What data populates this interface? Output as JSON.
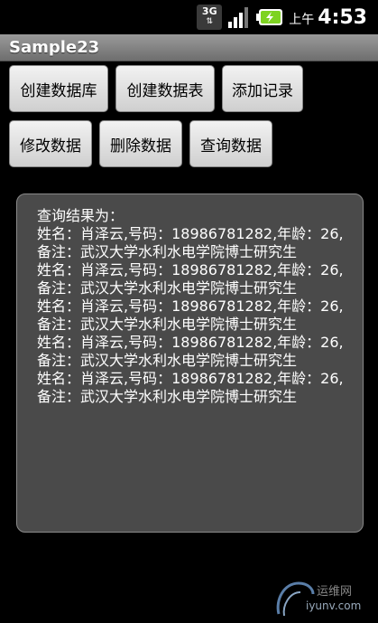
{
  "status_bar": {
    "network_type": "3G",
    "ampm": "上午",
    "time": "4:53"
  },
  "app": {
    "title": "Sample23"
  },
  "buttons": {
    "create_db": "创建数据库",
    "create_table": "创建数据表",
    "add_record": "添加记录",
    "update_data": "修改数据",
    "delete_data": "删除数据",
    "query_data": "查询数据"
  },
  "result": {
    "header": "查询结果为：",
    "records": [
      "姓名：肖泽云,号码：18986781282,年龄：26,备注：武汉大学水利水电学院博士研究生",
      "姓名：肖泽云,号码：18986781282,年龄：26,备注：武汉大学水利水电学院博士研究生",
      "姓名：肖泽云,号码：18986781282,年龄：26,备注：武汉大学水利水电学院博士研究生",
      "姓名：肖泽云,号码：18986781282,年龄：26,备注：武汉大学水利水电学院博士研究生",
      "姓名：肖泽云,号码：18986781282,年龄：26,备注：武汉大学水利水电学院博士研究生"
    ]
  },
  "watermark": {
    "name": "运维网",
    "url": "iyunv.com"
  },
  "colors": {
    "battery_accent": "#7ed321",
    "title_bar": "#8a8a8a",
    "panel_bg": "#4a4a4a"
  }
}
